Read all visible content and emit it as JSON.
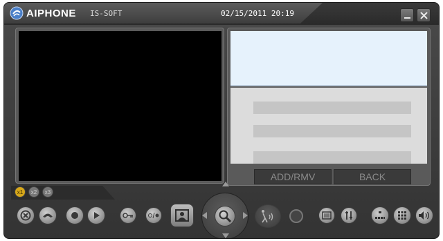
{
  "titlebar": {
    "brand": "AIPHONE",
    "product": "IS-SOFT",
    "datetime": "02/15/2011 20:19"
  },
  "right_panel": {
    "add_rmv_label": "ADD/RMV",
    "back_label": "BACK"
  },
  "zoom": {
    "x1": "x1",
    "x2": "x2",
    "x3": "x3",
    "selected": "x1"
  },
  "icons": {
    "logo": "aiphone-logo-icon",
    "minimize": "minimize-icon",
    "close": "close-icon",
    "toolbar": [
      "cancel-icon",
      "handset-icon",
      "record-icon",
      "play-icon",
      "door-release-icon",
      "dimmer-icon",
      "snapshot-icon",
      "zoom-pan-icon",
      "talk-icon",
      "status-indicator",
      "list-icon",
      "settings-icon",
      "network-icon",
      "grid-icon",
      "volume-icon"
    ]
  },
  "colors": {
    "accent_zoom": "#d6a71a",
    "info_box": "#e6f2fc",
    "background": "#3c3c3c"
  }
}
